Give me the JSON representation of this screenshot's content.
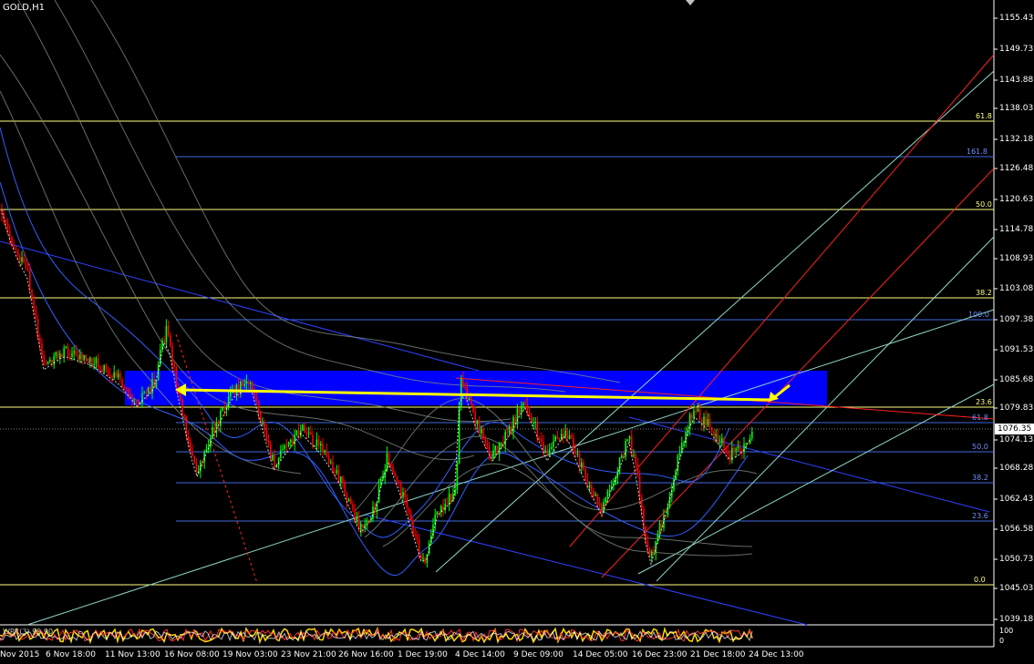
{
  "chart": {
    "symbol_title": "GOLD,H1",
    "current_price": "1076.35"
  },
  "price_axis": [
    "1155.43",
    "1149.73",
    "1143.88",
    "1138.03",
    "1132.18",
    "1126.48",
    "1120.63",
    "1114.78",
    "1108.93",
    "1103.08",
    "1097.38",
    "1091.53",
    "1085.68",
    "1079.83",
    "1074.13",
    "1068.28",
    "1062.43",
    "1056.58",
    "1050.73",
    "1045.03",
    "1039.18"
  ],
  "time_axis": [
    "Nov 2015",
    "6 Nov 18:00",
    "11 Nov 13:00",
    "16 Nov 08:00",
    "19 Nov 03:00",
    "23 Nov 21:00",
    "26 Nov 16:00",
    "1 Dec 19:00",
    "4 Dec 14:00",
    "9 Dec 09:00",
    "14 Dec 05:00",
    "16 Dec 23:00",
    "21 Dec 18:00",
    "24 Dec 13:00"
  ],
  "fib_yellow": [
    "61.8",
    "50.0",
    "38.2",
    "23.6",
    "0.0"
  ],
  "fib_blue": [
    "161.8",
    "100.0",
    "61.8",
    "50.0",
    "38.2",
    "23.6"
  ],
  "indicator": {
    "label": "WPR(3) 99.90",
    "axis_top": "100",
    "axis_bottom": "0"
  },
  "colors": {
    "background": "#000000",
    "bull_candle": "#00ff00",
    "bear_candle": "#ff0000",
    "fib_yellow": "#ffff80",
    "fib_blue": "#4169e1",
    "zone": "#0000ff",
    "arrow": "#ffff00"
  }
}
